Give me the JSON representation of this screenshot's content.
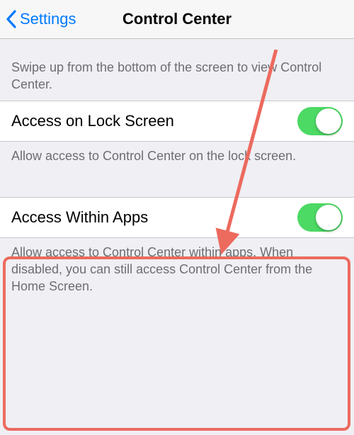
{
  "nav": {
    "back_label": "Settings",
    "title": "Control Center"
  },
  "section1": {
    "header": "Swipe up from the bottom of the screen to view Control Center.",
    "row_label": "Access on Lock Screen",
    "row_on": true,
    "footer": "Allow access to Control Center on the lock screen."
  },
  "section2": {
    "row_label": "Access Within Apps",
    "row_on": true,
    "footer": "Allow access to Control Center within apps. When disabled, you can still access Control Center from the Home Screen."
  },
  "colors": {
    "tint": "#007aff",
    "switch_on": "#4cd964",
    "annotation": "#ec6a5e"
  }
}
